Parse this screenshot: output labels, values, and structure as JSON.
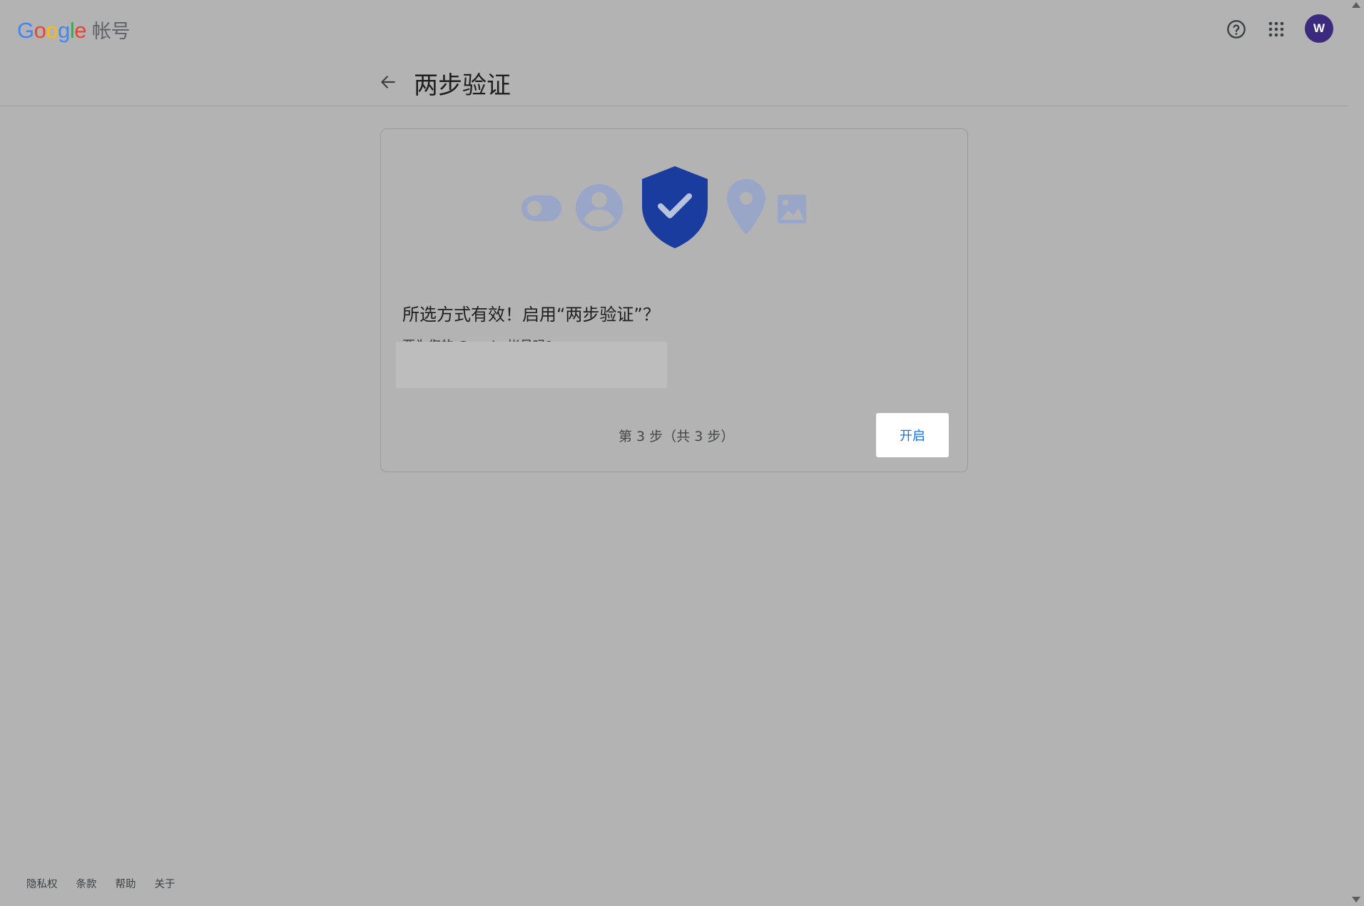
{
  "header": {
    "logo_letters": [
      "G",
      "o",
      "o",
      "g",
      "l",
      "e"
    ],
    "product_name": "帐号",
    "avatar_initial": "W",
    "avatar_color": "#3c2a7e"
  },
  "title_row": {
    "title": "两步验证"
  },
  "card": {
    "heading": "所选方式有效！启用“两步验证”？",
    "description": "要为您的 Google 帐号吗?",
    "step_indicator": "第 3 步（共 3 步）",
    "turn_on_label": "开启",
    "accent_color": "#1a73e8",
    "shield_color": "#1a3c9e"
  },
  "footer": {
    "links": [
      "隐私权",
      "条款",
      "帮助",
      "关于"
    ]
  },
  "icons": {
    "help": "help-circle-icon",
    "apps": "apps-grid-icon",
    "back": "arrow-back-icon"
  }
}
